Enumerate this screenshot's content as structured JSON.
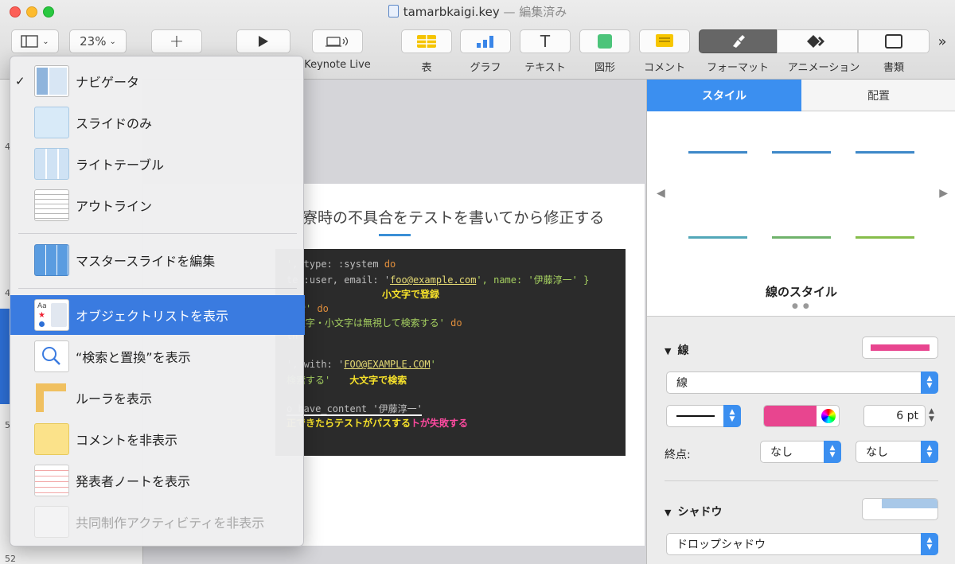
{
  "window": {
    "title": "tamarbkaigi.key",
    "subtitle": "— 編集済み"
  },
  "toolbar": {
    "zoom": "23%",
    "plus": "+",
    "keynote_live": "Keynote Live",
    "table": "表",
    "chart": "グラフ",
    "text": "テキスト",
    "shape": "図形",
    "comment": "コメント",
    "format": "フォーマット",
    "animate": "アニメーション",
    "document": "書類",
    "more": "»"
  },
  "view_menu": {
    "items": [
      {
        "label": "ナビゲータ",
        "checked": true
      },
      {
        "label": "スライドのみ"
      },
      {
        "label": "ライトテーブル"
      },
      {
        "label": "アウトライン"
      },
      {
        "label": "マスタースライドを編集"
      },
      {
        "label": "オブジェクトリストを表示",
        "highlighted": true
      },
      {
        "label": "“検索と置換”を表示"
      },
      {
        "label": "ルーラを表示"
      },
      {
        "label": "コメントを非表示"
      },
      {
        "label": "発表者ノートを表示"
      },
      {
        "label": "共同制作アクティビティを非表示",
        "disabled": true
      }
    ],
    "check": "✓"
  },
  "slide": {
    "title": "寮時の不具合をテストを書いてから修正する",
    "code_lines": [
      {
        "a": "'",
        "b": ", type: :system ",
        "c": "do"
      },
      {
        "a": "te :user, email: '",
        "u": "foo@example.com",
        "b": "', name: '伊藤淳一' }"
      },
      {
        "ann": "小文字で登録"
      },
      {
        "a": "検索' ",
        "c": "do"
      },
      {
        "a": "大文字・小文字は無視して検索する' ",
        "c": "do"
      },
      {
        "a": "th"
      },
      {
        "a": ""
      },
      {
        "a": "', with: '",
        "u": "FOO@EXAMPLE.COM",
        "b": "'"
      },
      {
        "a": "検索する'",
        "ann": "大文字で検索"
      },
      {
        "a": ""
      },
      {
        "a": "o have_content '伊藤淳一'"
      },
      {
        "ann": "正できたらテストがパスする",
        "pink": "トが失敗する"
      }
    ]
  },
  "inspector": {
    "tab_style": "スタイル",
    "tab_arrange": "配置",
    "line_styles_label": "線のスタイル",
    "stroke_section": "線",
    "stroke_type": "線",
    "stroke_width": "6 pt",
    "endpoints_label": "終点:",
    "endpoint_left": "なし",
    "endpoint_right": "なし",
    "shadow_section": "シャドウ",
    "shadow_type": "ドロップシャドウ",
    "colors": {
      "accent": "#3b8ff0",
      "stroke": "#e8458f"
    }
  },
  "navigator": {
    "numbers": [
      "4",
      "4",
      "5",
      "52"
    ]
  }
}
